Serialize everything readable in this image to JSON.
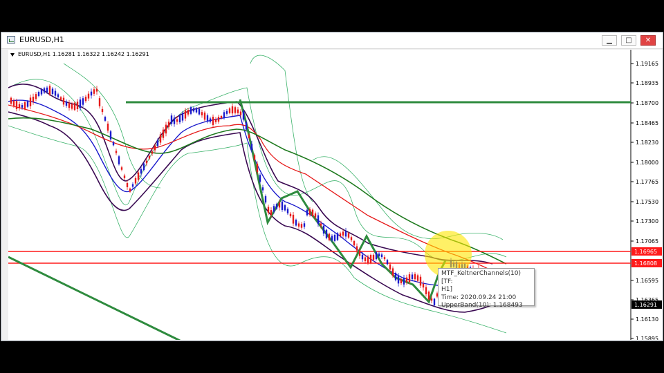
{
  "window": {
    "title": "EURUSD,H1",
    "buttons": {
      "minimize": "▁",
      "maximize": "□",
      "close": "✕"
    }
  },
  "chart": {
    "symbol_line": "EURUSD,H1  1.16281 1.16322 1.16242 1.16291",
    "price_labels": [
      "1.19165",
      "1.18935",
      "1.18700",
      "1.18465",
      "1.18230",
      "1.18000",
      "1.17765",
      "1.17530",
      "1.17300",
      "1.17065",
      "1.16595",
      "1.16365",
      "1.16130",
      "1.15895"
    ],
    "hline_labels": [
      "1.16965",
      "1.16808"
    ],
    "current_price": "1.16291",
    "colors": {
      "resistance_line": "#2e8b3e",
      "support_lines": "#ff1a1a",
      "current_price_bg": "#000000",
      "highlight": "#ffe600"
    }
  },
  "tooltip": {
    "line1": "MTF_KeltnerChannels(10)[TF:",
    "line2": "H1]",
    "line3": "Time: 2020.09.24 21:00",
    "line4": "UpperBand(10): 1.168493"
  }
}
